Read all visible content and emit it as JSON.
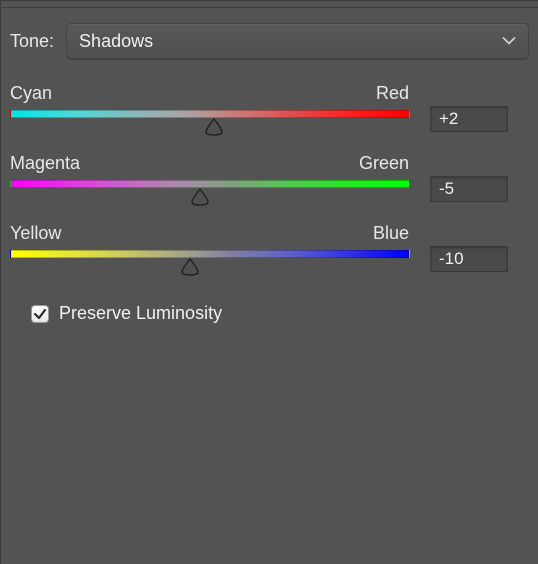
{
  "tone": {
    "label": "Tone:",
    "selected": "Shadows"
  },
  "sliders": [
    {
      "left_label": "Cyan",
      "right_label": "Red",
      "value": 2,
      "value_display": "+2"
    },
    {
      "left_label": "Magenta",
      "right_label": "Green",
      "value": -5,
      "value_display": "-5"
    },
    {
      "left_label": "Yellow",
      "right_label": "Blue",
      "value": -10,
      "value_display": "-10"
    }
  ],
  "preserve_luminosity": {
    "label": "Preserve Luminosity",
    "checked": true
  }
}
